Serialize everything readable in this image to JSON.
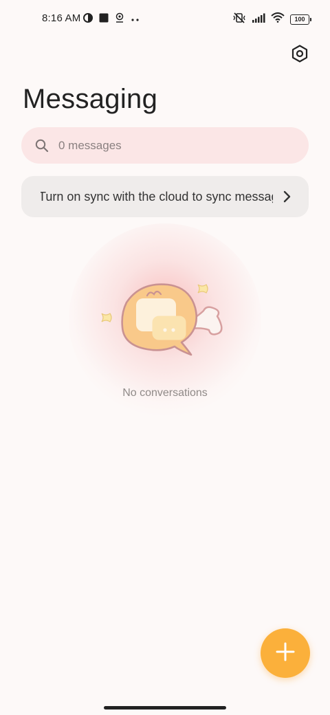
{
  "status_bar": {
    "time": "8:16 AM",
    "battery_level": "100",
    "left_icons": [
      "data-saver-icon",
      "square-notification-icon",
      "location-pin-icon",
      "more-dots-icon"
    ],
    "right_icons": [
      "vibrate-off-icon",
      "signal-icon",
      "wifi-icon",
      "battery-icon"
    ]
  },
  "header": {
    "title": "Messaging",
    "settings_icon": "settings-hexagon-icon"
  },
  "search": {
    "placeholder": "0 messages",
    "value": ""
  },
  "sync_banner": {
    "text": "Turn on sync with the cloud to sync messages",
    "chevron_icon": "chevron-right-icon"
  },
  "empty_state": {
    "illustration": "message-bubble-fish-illustration",
    "text": "No conversations"
  },
  "fab": {
    "icon": "plus-icon",
    "color": "#fbb03b"
  },
  "colors": {
    "background": "#fdf9f8",
    "search_bg": "#fbe6e6",
    "banner_bg": "#efeceb",
    "accent": "#fbb03b"
  }
}
